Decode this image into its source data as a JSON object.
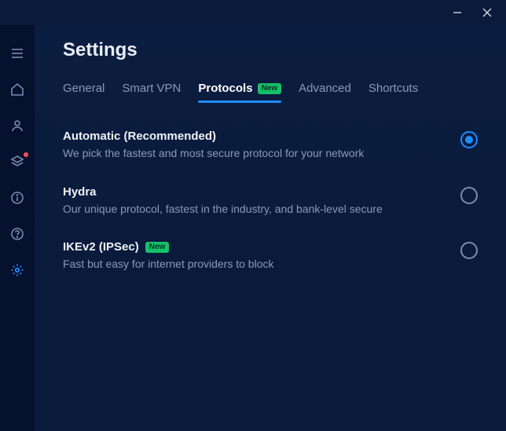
{
  "header": {
    "title": "Settings"
  },
  "tabs": [
    {
      "label": "General",
      "active": false,
      "badge": null
    },
    {
      "label": "Smart VPN",
      "active": false,
      "badge": null
    },
    {
      "label": "Protocols",
      "active": true,
      "badge": "New"
    },
    {
      "label": "Advanced",
      "active": false,
      "badge": null
    },
    {
      "label": "Shortcuts",
      "active": false,
      "badge": null
    }
  ],
  "options": [
    {
      "title": "Automatic (Recommended)",
      "desc": "We pick the fastest and most secure protocol for your network",
      "badge": null,
      "selected": true
    },
    {
      "title": "Hydra",
      "desc": "Our unique protocol, fastest in the industry, and bank-level secure",
      "badge": null,
      "selected": false
    },
    {
      "title": "IKEv2 (IPSec)",
      "desc": "Fast but easy for internet providers to block",
      "badge": "New",
      "selected": false
    }
  ],
  "colors": {
    "accent": "#1f8cff",
    "badge_green": "#16c06a",
    "bg_dark": "#0a1a3a",
    "sidebar_bg": "#06112e"
  }
}
